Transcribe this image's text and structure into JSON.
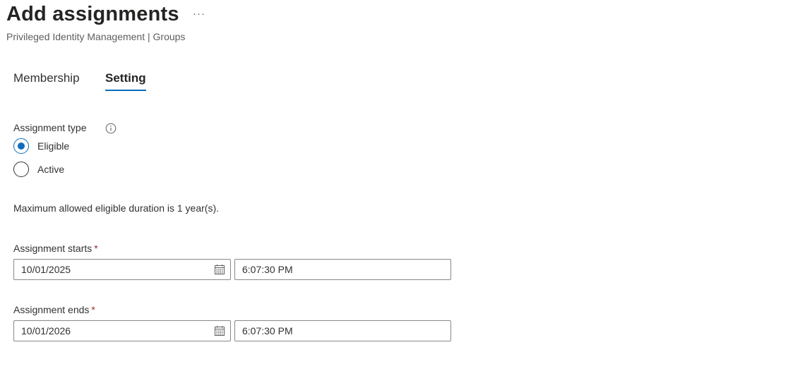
{
  "header": {
    "title": "Add assignments",
    "more_label": "···",
    "subtitle": "Privileged Identity Management | Groups"
  },
  "tabs": [
    {
      "label": "Membership",
      "selected": false
    },
    {
      "label": "Setting",
      "selected": true
    }
  ],
  "assignment_type": {
    "label": "Assignment type",
    "options": [
      {
        "label": "Eligible",
        "checked": true
      },
      {
        "label": "Active",
        "checked": false
      }
    ]
  },
  "duration_note": "Maximum allowed eligible duration is 1 year(s).",
  "starts": {
    "label": "Assignment starts",
    "required_mark": "*",
    "date": "10/01/2025",
    "time": "6:07:30 PM"
  },
  "ends": {
    "label": "Assignment ends",
    "required_mark": "*",
    "date": "10/01/2026",
    "time": "6:07:30 PM"
  },
  "colors": {
    "accent": "#0f6cbd",
    "required": "#a4262c"
  }
}
